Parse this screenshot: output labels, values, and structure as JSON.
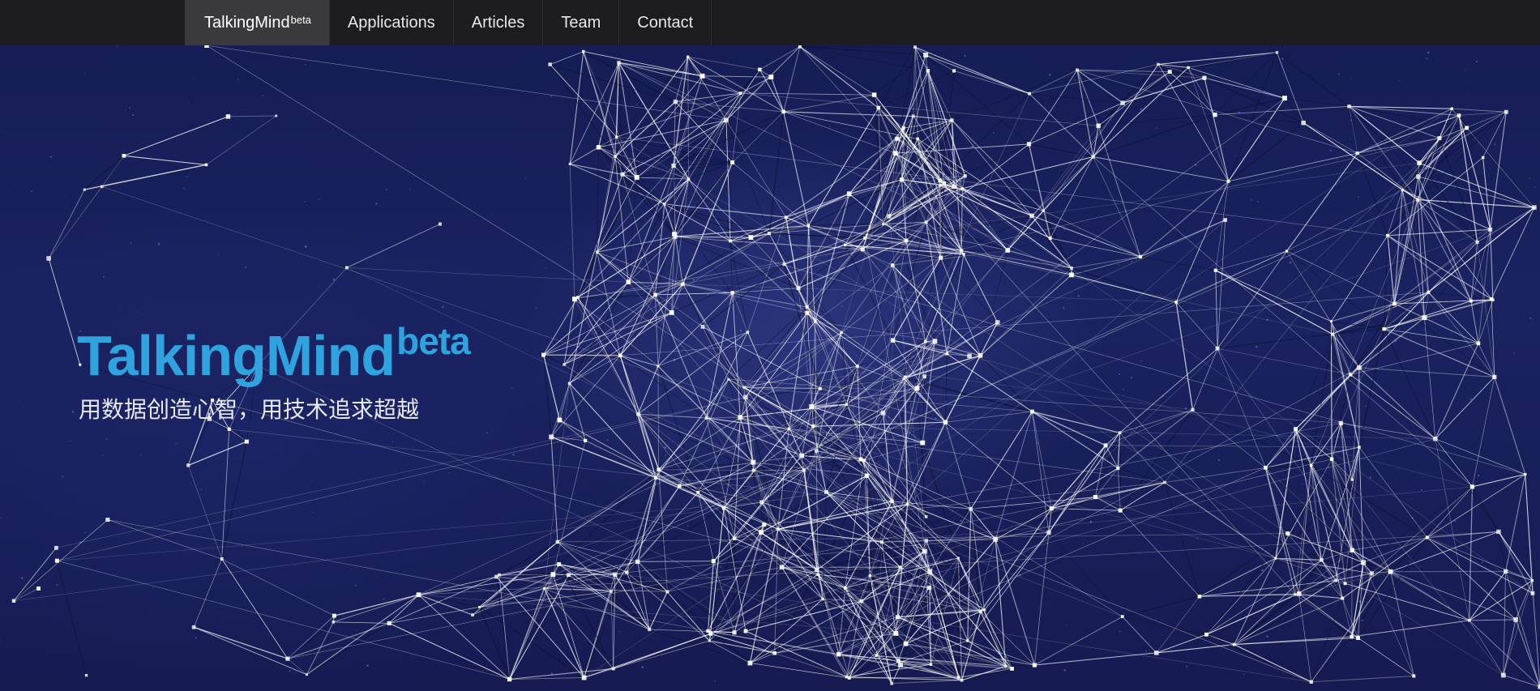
{
  "nav": {
    "brand": {
      "label": "TalkingMind",
      "suffix": "beta"
    },
    "items": [
      {
        "label": "Applications"
      },
      {
        "label": "Articles"
      },
      {
        "label": "Team"
      },
      {
        "label": "Contact"
      }
    ]
  },
  "hero": {
    "title": "TalkingMind",
    "title_suffix": "beta",
    "subtitle": "用数据创造心智，用技术追求超越"
  },
  "colors": {
    "navbar_bg": "#1d1d1f",
    "brand_active_bg": "#3a3a3c",
    "hero_bg": "#161d55",
    "accent": "#2ea3dd",
    "network_line": "#ffffff"
  }
}
